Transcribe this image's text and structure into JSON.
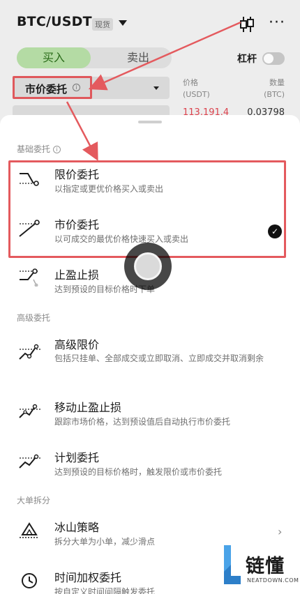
{
  "header": {
    "pair": "BTC/USDT",
    "market_tag": "现货",
    "candle_icon": "candlestick-icon",
    "more_icon": "more-icon"
  },
  "trade_tabs": {
    "buy": "买入",
    "sell": "卖出"
  },
  "leverage": {
    "label": "杠杆",
    "enabled": false
  },
  "order_type_select": {
    "value": "市价委托",
    "info_icon": "info-icon"
  },
  "orderbook": {
    "price_header": "价格\n(USDT)",
    "qty_header": "数量\n(BTC)",
    "rows": [
      {
        "price": "113,191.4",
        "qty": "0.03798"
      }
    ]
  },
  "sheet": {
    "sections": [
      {
        "title": "基础委托",
        "has_info": true,
        "items": [
          {
            "title": "限价委托",
            "desc": "以指定或更优价格买入或卖出",
            "icon": "limit-order-icon",
            "selected": false
          },
          {
            "title": "市价委托",
            "desc": "以可成交的最优价格快速买入或卖出",
            "icon": "market-order-icon",
            "selected": true
          },
          {
            "title": "止盈止损",
            "desc": "达到预设的目标价格时下单",
            "icon": "take-profit-stop-loss-icon",
            "selected": false
          }
        ]
      },
      {
        "title": "高级委托",
        "has_info": false,
        "items": [
          {
            "title": "高级限价",
            "desc": "包括只挂单、全部成交或立即取消、立即成交并取消剩余",
            "icon": "advanced-limit-icon"
          },
          {
            "title": "移动止盈止损",
            "desc": "跟踪市场价格，达到预设值后自动执行市价委托",
            "icon": "trailing-stop-icon"
          },
          {
            "title": "计划委托",
            "desc": "达到预设的目标价格时，触发限价或市价委托",
            "icon": "trigger-order-icon"
          }
        ]
      },
      {
        "title": "大单拆分",
        "has_info": false,
        "items": [
          {
            "title": "冰山策略",
            "desc": "拆分大单为小单，减少滑点",
            "icon": "iceberg-icon",
            "has_chevron": true
          },
          {
            "title": "时间加权委托",
            "desc": "按自定义时间间隔触发委托",
            "icon": "twap-clock-icon"
          }
        ]
      }
    ]
  },
  "watermark": {
    "text": "链懂",
    "sub": "NEATDOWN.COM"
  },
  "colors": {
    "accent_red": "#e45a5e",
    "buy_green": "#b8e0a8",
    "sell_red": "#e0444f"
  }
}
